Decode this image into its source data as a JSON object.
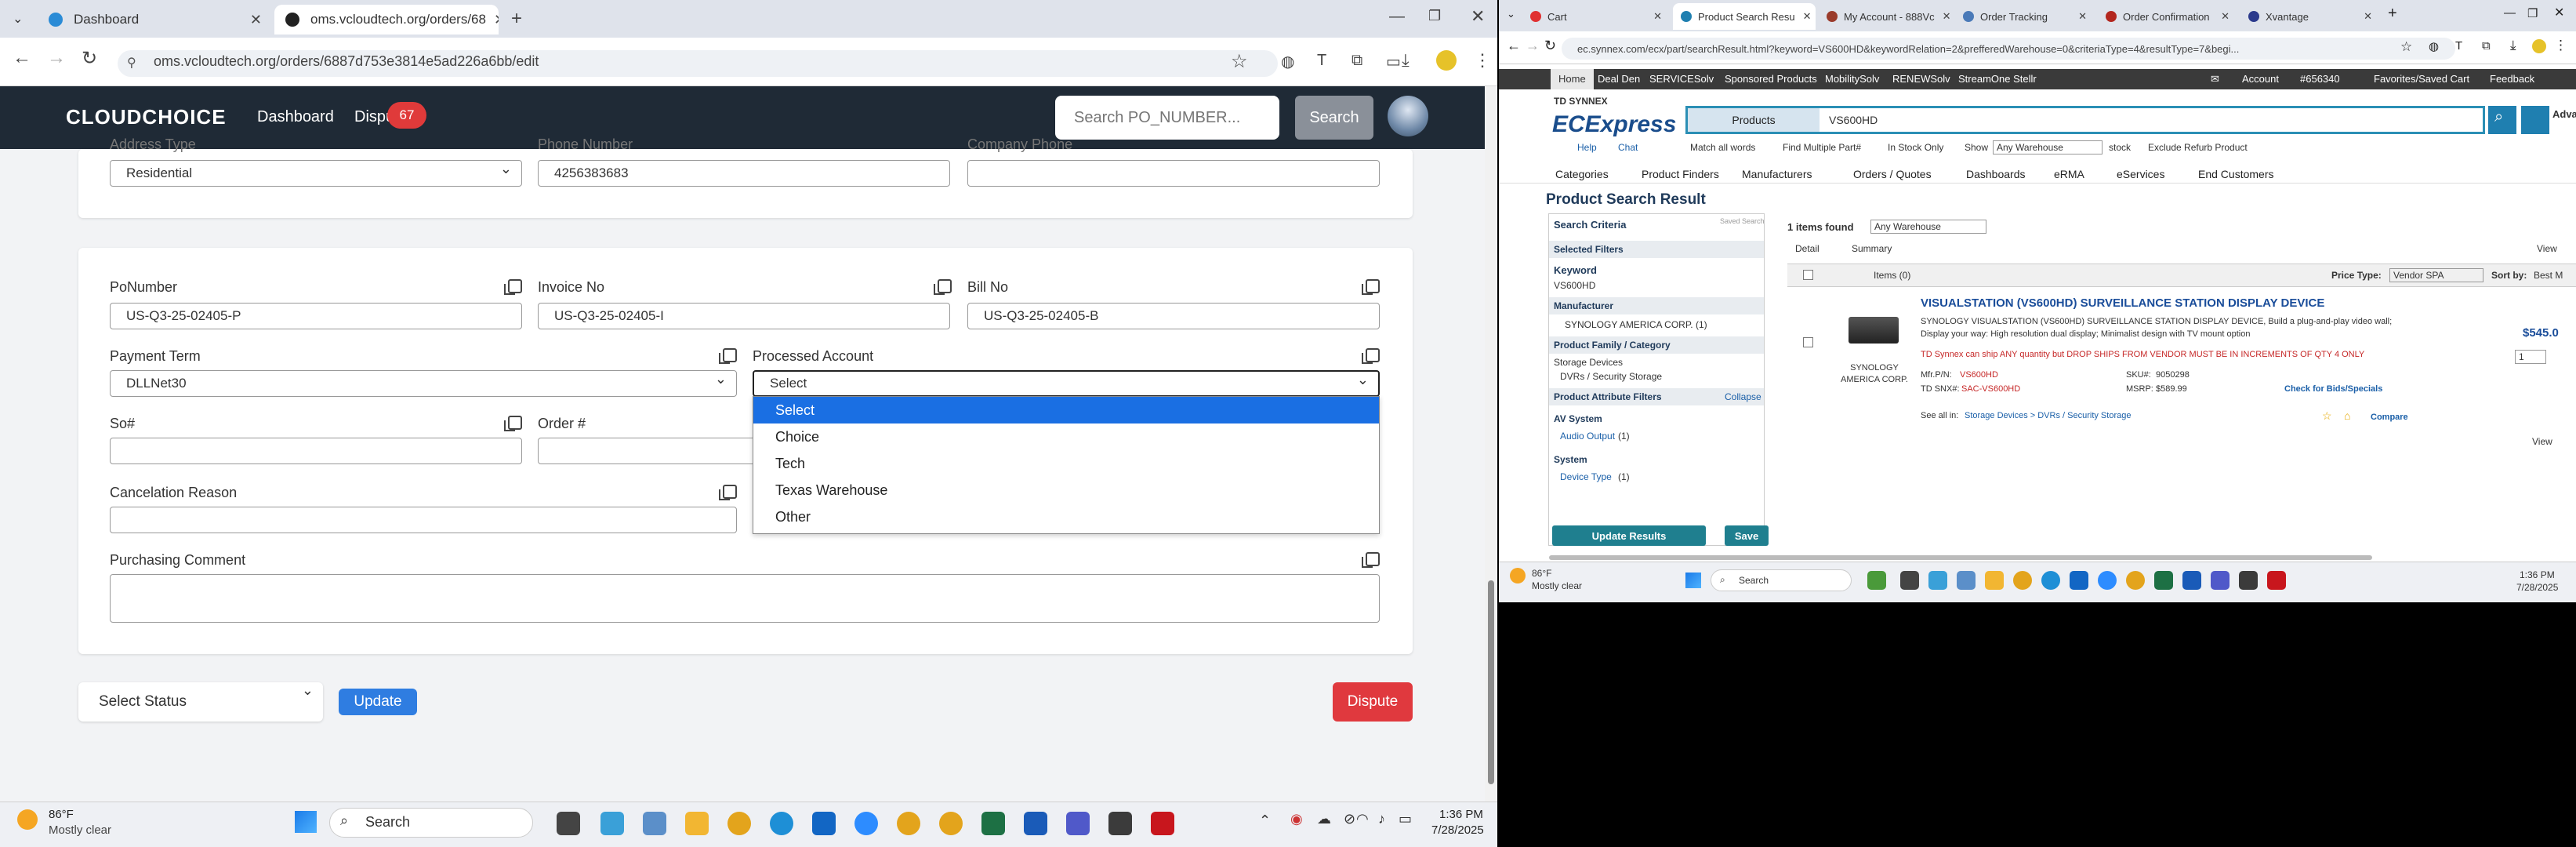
{
  "left_browser": {
    "tabs": [
      {
        "title": "Dashboard",
        "active": false
      },
      {
        "title": "oms.vcloudtech.org/orders/68",
        "active": true
      }
    ],
    "url": "oms.vcloudtech.org/orders/6887d753e3814e5ad226a6bb/edit",
    "app": {
      "logo": "CLOUDCHOICE",
      "nav": {
        "dashboard": "Dashboard",
        "disputes": "Dispu",
        "dispute_count": "67"
      },
      "search": {
        "placeholder": "Search PO_NUMBER...",
        "button": "Search"
      }
    },
    "top_card": {
      "address_type_label": "Address Type",
      "address_type_value": "Residential",
      "phone_label": "Phone Number",
      "phone_value": "4256383683",
      "company_phone_label": "Company Phone",
      "company_phone_value": ""
    },
    "form": {
      "po_number": {
        "label": "PoNumber",
        "value": "US-Q3-25-02405-P"
      },
      "invoice_no": {
        "label": "Invoice No",
        "value": "US-Q3-25-02405-I"
      },
      "bill_no": {
        "label": "Bill No",
        "value": "US-Q3-25-02405-B"
      },
      "payment_term": {
        "label": "Payment Term",
        "value": "DLLNet30"
      },
      "processed_account": {
        "label": "Processed Account",
        "value": "Select",
        "options": [
          "Select",
          "Choice",
          "Tech",
          "Texas Warehouse",
          "Other"
        ]
      },
      "so_number": {
        "label": "So#",
        "value": ""
      },
      "order_number": {
        "label": "Order #",
        "value": ""
      },
      "cancel_reason": {
        "label": "Cancelation Reason",
        "value": ""
      },
      "purchasing_comment": {
        "label": "Purchasing Comment",
        "value": ""
      }
    },
    "actions": {
      "status_placeholder": "Select Status",
      "update": "Update",
      "dispute": "Dispute"
    },
    "taskbar": {
      "temp": "86°F",
      "weather": "Mostly clear",
      "search": "Search",
      "time": "1:36 PM",
      "date": "7/28/2025"
    }
  },
  "right_browser": {
    "tabs": [
      "Cart",
      "Product Search Resu",
      "My Account - 888Vc",
      "Order Tracking",
      "Order Confirmation",
      "Xvantage"
    ],
    "active_tab": 1,
    "url": "ec.synnex.com/ecx/part/searchResult.html?keyword=VS600HD&keywordRelation=2&prefferedWarehouse=0&criteriaType=4&resultType=7&begi...",
    "topnav": [
      "Home",
      "Deal Den",
      "SERVICESolv",
      "Sponsored Products",
      "MobilitySolv",
      "RENEWSolv",
      "StreamOne Stellr"
    ],
    "topnav_right": {
      "account": "Account",
      "account_no": "#656340",
      "favorites": "Favorites/Saved Cart",
      "feedback": "Feedback"
    },
    "brand": {
      "td": "TD SYNNEX",
      "ec": "ECExpress"
    },
    "search": {
      "dropdown": "Products",
      "keyword": "VS600HD",
      "advanced": "Advanced Search"
    },
    "help": "Help",
    "chat": "Chat",
    "search_options": {
      "match_all": "Match all words",
      "find_multiple": "Find Multiple Part#",
      "in_stock": "In Stock Only",
      "show_label": "Show",
      "warehouse": "Any Warehouse",
      "stock": "stock",
      "exclude_refurb": "Exclude Refurb Product"
    },
    "categories": [
      "Categories",
      "Product Finders",
      "Manufacturers",
      "Orders / Quotes",
      "Dashboards",
      "eRMA",
      "eServices",
      "End Customers"
    ],
    "page_title": "Product Search Result",
    "sidebar": {
      "criteria": "Search Criteria",
      "saved": "Saved Searches",
      "selected_filters": "Selected Filters",
      "keyword_label": "Keyword",
      "keyword_value": "VS600HD",
      "manufacturer": "Manufacturer",
      "manufacturer_item": "SYNOLOGY AMERICA CORP. (1)",
      "family": "Product Family / Category",
      "family_1": "Storage Devices",
      "family_2": "DVRs / Security Storage",
      "attr_filters": "Product Attribute Filters",
      "collapse": "Collapse",
      "av": "AV System",
      "av_item": "Audio Output",
      "av_count": "(1)",
      "system": "System",
      "system_item": "Device Type",
      "system_count": "(1)",
      "update_btn": "Update Results",
      "save_btn": "Save"
    },
    "results": {
      "count": "1 items found",
      "warehouse": "Any Warehouse",
      "detail": "Detail",
      "summary": "Summary",
      "view": "View",
      "items": "Items (0)",
      "price_type_label": "Price Type:",
      "price_type": "Vendor SPA",
      "sort_label": "Sort by:",
      "sort": "Best M",
      "product": {
        "title": "VISUALSTATION (VS600HD) SURVEILLANCE STATION DISPLAY DEVICE",
        "desc1": "SYNOLOGY VISUALSTATION (VS600HD) SURVEILLANCE STATION DISPLAY DEVICE, Build a plug-and-play video wall;",
        "desc2": "Display your way: High resolution dual display; Minimalist design with TV mount option",
        "warning": "TD Synnex can ship ANY quantity but DROP SHIPS FROM VENDOR MUST BE IN INCREMENTS OF QTY 4 ONLY",
        "mfr_pn_label": "Mfr.P/N:",
        "mfr_pn": "VS600HD",
        "sku_label": "SKU#:",
        "sku": "9050298",
        "td_sku_label": "TD SNX#:",
        "td_sku": "SAC-VS600HD",
        "msrp_label": "MSRP:",
        "msrp": "$589.99",
        "bids": "Check for Bids/Specials",
        "see_all_label": "See all in:",
        "see_all": "Storage Devices > DVRs / Security Storage",
        "compare": "Compare",
        "vendor": "SYNOLOGY AMERICA CORP.",
        "price": "$545.0",
        "qty": "1"
      }
    },
    "taskbar": {
      "temp": "86°F",
      "weather": "Mostly clear",
      "search": "Search",
      "time": "1:36 PM",
      "date": "7/28/2025"
    }
  }
}
